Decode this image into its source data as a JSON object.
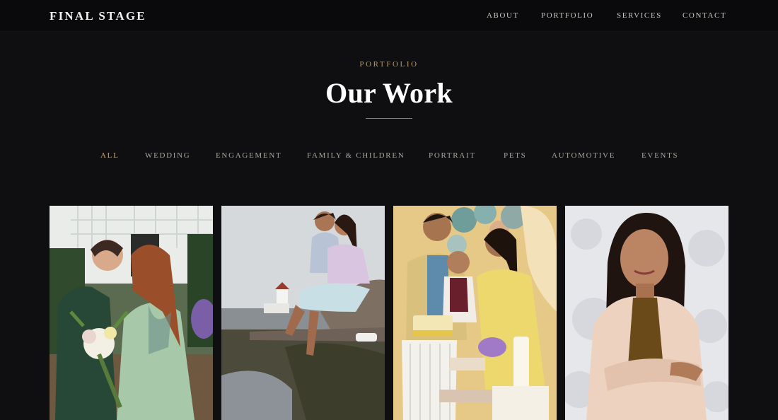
{
  "brand": "FINAL STAGE",
  "nav": [
    "ABOUT",
    "PORTFOLIO",
    "SERVICES",
    "CONTACT"
  ],
  "hero": {
    "eyebrow": "PORTFOLIO",
    "title": "Our Work"
  },
  "filters": [
    "ALL",
    "WEDDING",
    "ENGAGEMENT",
    "FAMILY & CHILDREN",
    "PORTRAIT",
    "PETS",
    "AUTOMOTIVE",
    "EVENTS"
  ],
  "active_filter": "ALL",
  "colors": {
    "background": "#0f0e10",
    "accent_gold": "#c7a56c",
    "text": "#e8e6e3"
  },
  "gallery": [
    {
      "subject": "wedding-couple-photo"
    },
    {
      "subject": "engagement-beach-photo"
    },
    {
      "subject": "family-birthday-photo"
    },
    {
      "subject": "portrait-woman-photo"
    }
  ]
}
